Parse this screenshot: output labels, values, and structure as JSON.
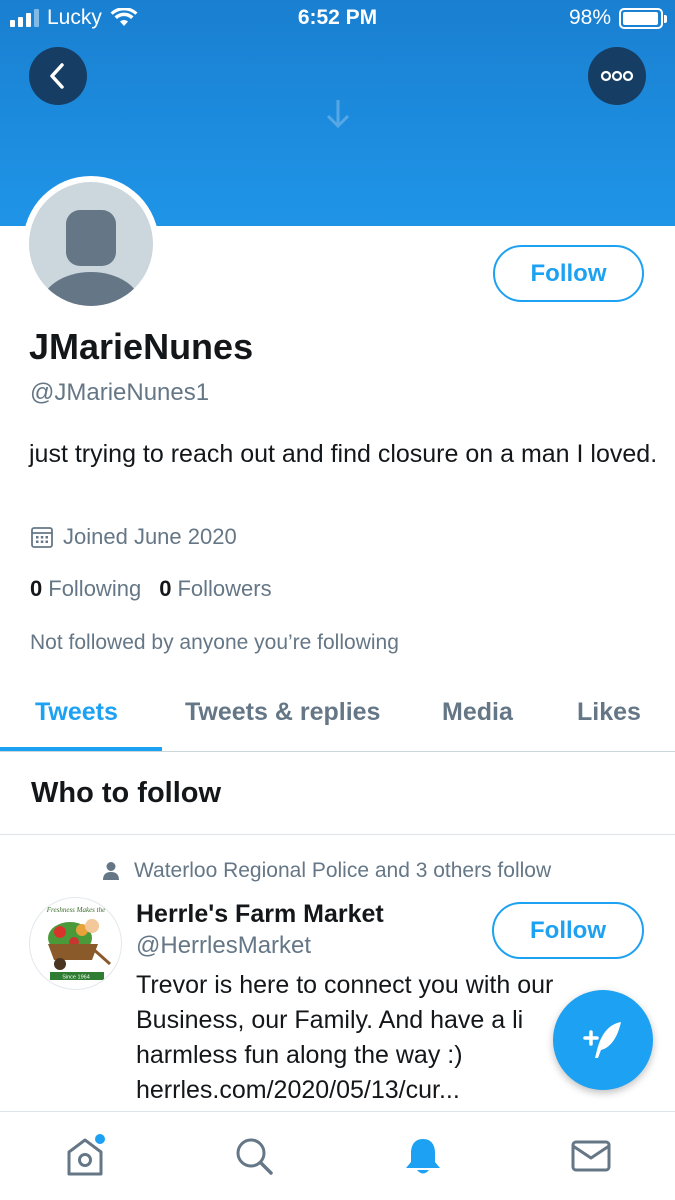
{
  "status_bar": {
    "carrier": "Lucky",
    "time": "6:52 PM",
    "battery": "98%",
    "battery_level": 0.98,
    "icons": [
      "signal-icon",
      "wifi-icon",
      "battery-icon"
    ]
  },
  "header": {
    "back_icon": "back-arrow-icon",
    "more_icon": "more-options-icon",
    "banner_color": "#1d8fe0",
    "button_color": "#163d63"
  },
  "profile": {
    "display_name": "JMarieNunes",
    "handle": "@JMarieNunes1",
    "bio": "just trying to reach out and find closure on a man I loved.",
    "joined": "Joined June 2020",
    "following_count": "0",
    "following_label": "Following",
    "followers_count": "0",
    "followers_label": "Followers",
    "not_followed_text": "Not followed by anyone you’re following",
    "follow_label": "Follow"
  },
  "tabs": [
    {
      "label": "Tweets",
      "active": true
    },
    {
      "label": "Tweets & replies",
      "active": false
    },
    {
      "label": "Media",
      "active": false
    },
    {
      "label": "Likes",
      "active": false
    }
  ],
  "who_to_follow": {
    "title": "Who to follow",
    "suggestion": {
      "social_context": "Waterloo Regional Police and 3 others follow",
      "name": "Herrle's Farm Market",
      "handle": "@HerrlesMarket",
      "follow_label": "Follow",
      "bio_lines": [
        "Trevor is here to connect you with our",
        "Business, our Family. And have a li",
        "harmless fun along the way :)",
        "herrles.com/2020/05/13/cur..."
      ],
      "avatar_text_top": "Freshness Makes the",
      "avatar_text_bottom": "Since 1964"
    }
  },
  "bottom_nav": {
    "items": [
      "home-icon",
      "search-icon",
      "notifications-icon",
      "messages-icon"
    ],
    "active": "notifications-icon"
  },
  "colors": {
    "accent": "#1da1f2",
    "text_secondary": "#657786",
    "text_primary": "#14171a"
  }
}
